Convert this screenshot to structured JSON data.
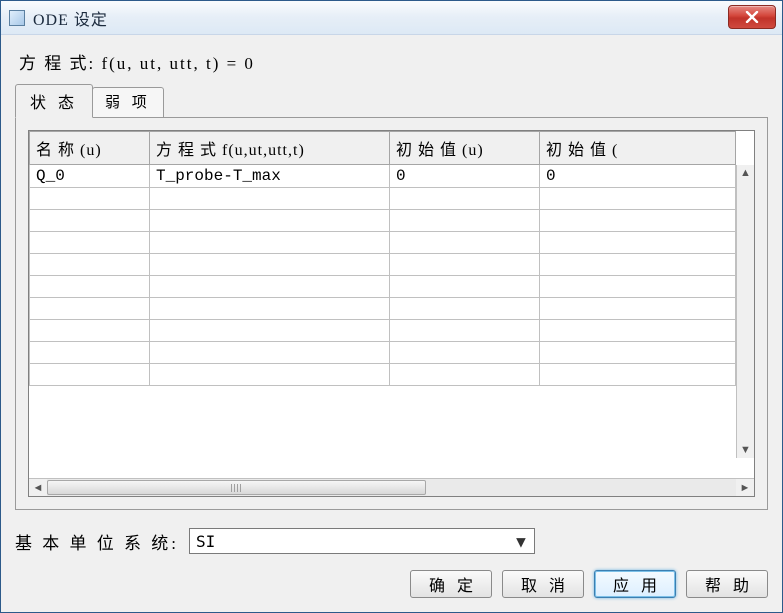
{
  "window": {
    "title": "ODE 设定"
  },
  "equation_label": "方 程 式: f(u, ut, utt, t) = 0",
  "tabs": {
    "state": "状 态",
    "weak": "弱 项"
  },
  "table": {
    "headers": {
      "name": "名 称 (u)",
      "equation": "方 程 式 f(u,ut,utt,t)",
      "init_u": "初 始 值 (u)",
      "init_ut": "初 始 值 ("
    },
    "rows": [
      {
        "name": "Q_0",
        "equation": "T_probe-T_max",
        "init_u": "0",
        "init_ut": "0"
      }
    ]
  },
  "unit_system": {
    "label": "基 本 单 位 系 统:",
    "value": "SI"
  },
  "buttons": {
    "ok": "确 定",
    "cancel": "取 消",
    "apply": "应 用",
    "help": "帮 助"
  }
}
